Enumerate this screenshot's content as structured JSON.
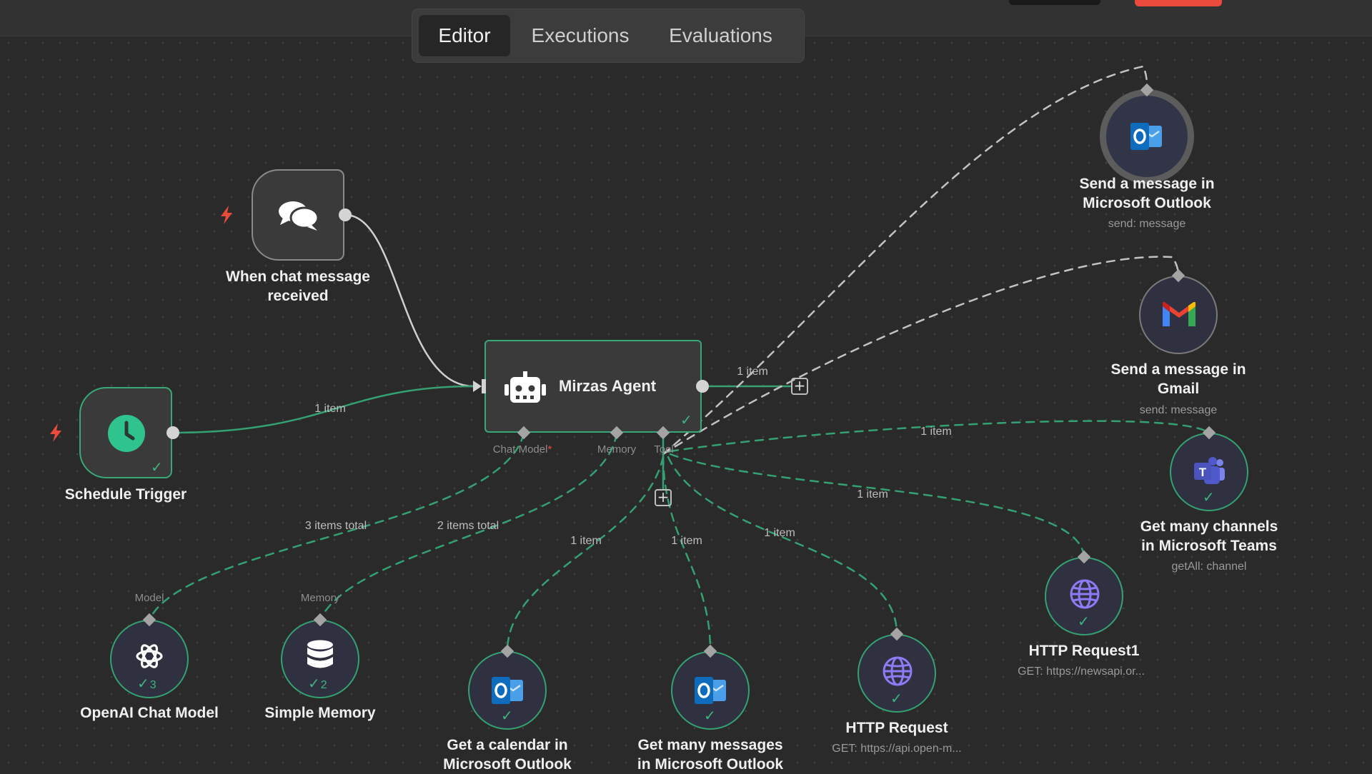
{
  "tabs": [
    {
      "label": "Editor",
      "active": true
    },
    {
      "label": "Executions",
      "active": false
    },
    {
      "label": "Evaluations",
      "active": false
    }
  ],
  "nodes": {
    "chat_trigger": {
      "title_line1": "When chat message",
      "title_line2": "received"
    },
    "schedule_trigger": {
      "title": "Schedule Trigger"
    },
    "agent": {
      "title": "Mirzas Agent",
      "ports": {
        "chat_model": "Chat Model",
        "memory": "Memory",
        "tool": "Tool"
      }
    },
    "openai_model": {
      "title": "OpenAI Chat Model",
      "port": "Model",
      "run_count": "3"
    },
    "simple_memory": {
      "title": "Simple Memory",
      "port": "Memory",
      "run_count": "2"
    },
    "outlook_calendar": {
      "title_line1": "Get a calendar in",
      "title_line2": "Microsoft Outlook"
    },
    "outlook_messages": {
      "title_line1": "Get many messages",
      "title_line2": "in Microsoft Outlook"
    },
    "http_request": {
      "title": "HTTP Request",
      "subtitle": "GET: https://api.open-m..."
    },
    "http_request1": {
      "title": "HTTP Request1",
      "subtitle": "GET: https://newsapi.or..."
    },
    "teams_channels": {
      "title_line1": "Get many channels",
      "title_line2": "in Microsoft Teams",
      "subtitle": "getAll: channel"
    },
    "gmail_send": {
      "title_line1": "Send a message in",
      "title_line2": "Gmail",
      "subtitle": "send: message"
    },
    "outlook_send": {
      "title_line1": "Send a message in",
      "title_line2": "Microsoft Outlook",
      "subtitle": "send: message"
    }
  },
  "edge_labels": {
    "schedule_to_agent": "1 item",
    "agent_output": "1 item",
    "model_total": "3 items total",
    "memory_total": "2 items total",
    "calendar": "1 item",
    "messages": "1 item",
    "http": "1 item",
    "http1": "1 item",
    "teams": "1 item"
  },
  "icons": {
    "chat": "chat-bubbles-icon",
    "schedule": "clock-icon",
    "agent": "robot-icon",
    "openai": "openai-icon",
    "memory": "database-icon",
    "outlook": "outlook-icon",
    "gmail": "gmail-icon",
    "teams": "teams-icon",
    "http": "globe-icon",
    "trigger": "lightning-bolt-icon",
    "add": "plus-icon",
    "success": "check-icon"
  },
  "colors": {
    "canvas": "#2a2a2a",
    "success": "#35a072",
    "trigger_bolt": "#ea4b3c",
    "primary_button": "#ea4b3c",
    "outlook_blue": "#0f6cbd",
    "teams_purple": "#5059c9",
    "globe_purple": "#8b7cf6"
  }
}
